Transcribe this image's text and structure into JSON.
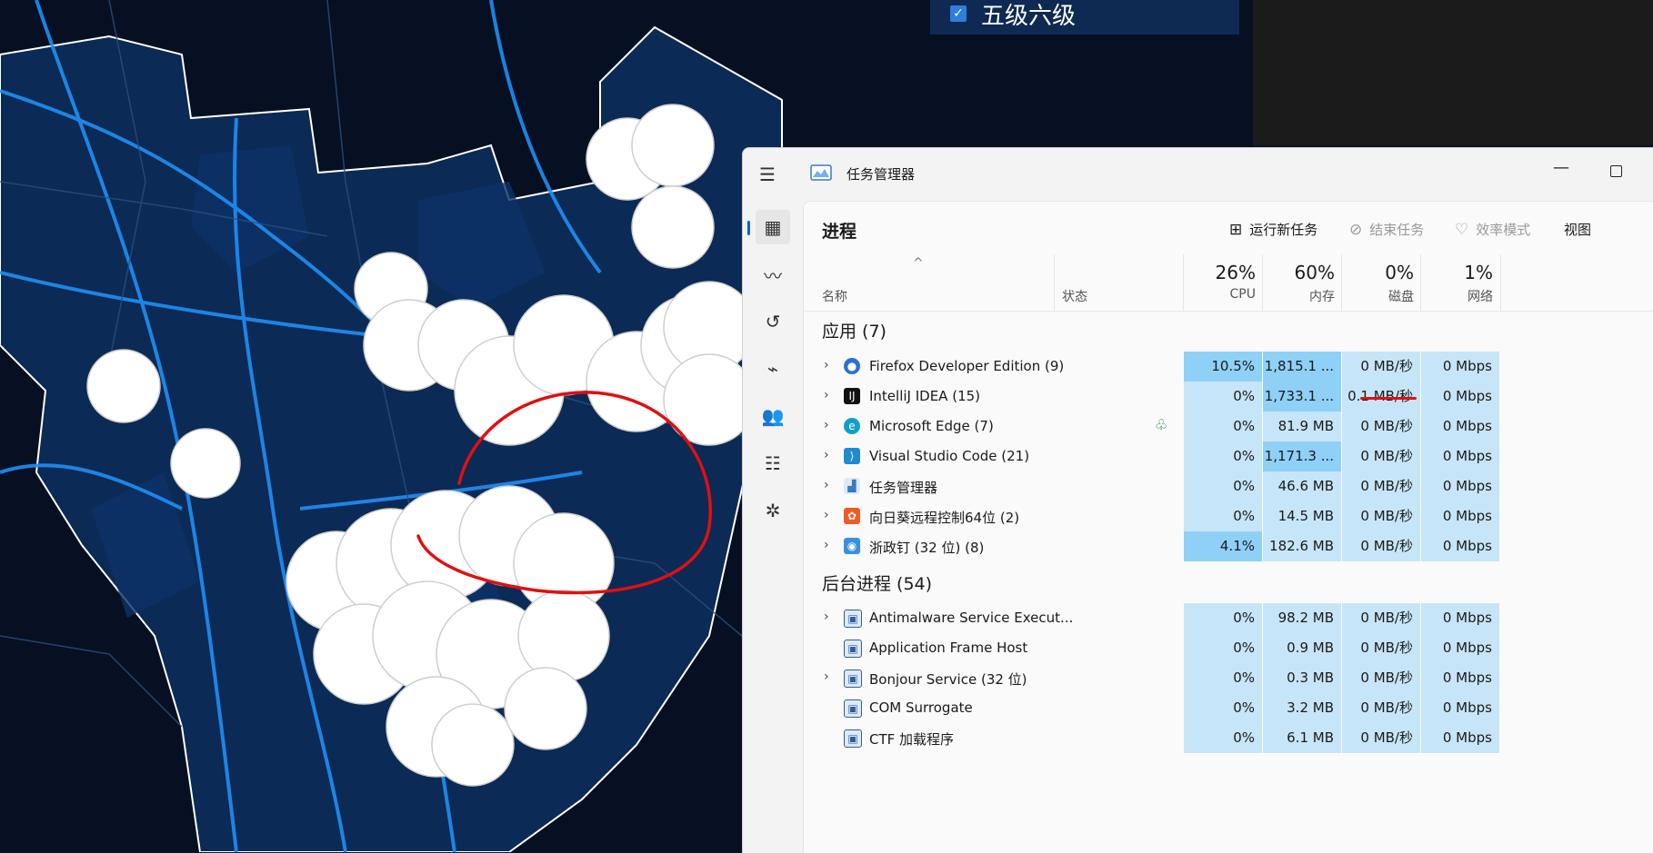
{
  "map": {
    "layer_toggle_label": "五级六级"
  },
  "taskmanager": {
    "title": "任务管理器",
    "page_title": "进程",
    "commands": {
      "run_new_task": "运行新任务",
      "end_task": "结束任务",
      "efficiency_mode": "效率模式",
      "view": "视图"
    },
    "columns": {
      "name": "名称",
      "status": "状态",
      "cpu_pct": "26%",
      "cpu": "CPU",
      "mem_pct": "60%",
      "mem": "内存",
      "disk_pct": "0%",
      "disk": "磁盘",
      "net_pct": "1%",
      "net": "网络"
    },
    "groups": {
      "apps": "应用 (7)",
      "background": "后台进程 (54)"
    },
    "apps": [
      {
        "name": "Firefox Developer Edition (9)",
        "icon": "firefox-icon",
        "cpu": "10.5%",
        "mem": "1,815.1 ...",
        "disk": "0 MB/秒",
        "net": "0 Mbps"
      },
      {
        "name": "IntelliJ IDEA (15)",
        "icon": "intellij-icon",
        "cpu": "0%",
        "mem": "1,733.1 ...",
        "disk": "0.1 MB/秒",
        "net": "0 Mbps"
      },
      {
        "name": "Microsoft Edge (7)",
        "icon": "edge-icon",
        "cpu": "0%",
        "mem": "81.9 MB",
        "disk": "0 MB/秒",
        "net": "0 Mbps"
      },
      {
        "name": "Visual Studio Code (21)",
        "icon": "vscode-icon",
        "cpu": "0%",
        "mem": "1,171.3 ...",
        "disk": "0 MB/秒",
        "net": "0 Mbps"
      },
      {
        "name": "任务管理器",
        "icon": "task-manager-icon",
        "cpu": "0%",
        "mem": "46.6 MB",
        "disk": "0 MB/秒",
        "net": "0 Mbps"
      },
      {
        "name": "向日葵远程控制64位 (2)",
        "icon": "sunlogin-icon",
        "cpu": "0%",
        "mem": "14.5 MB",
        "disk": "0 MB/秒",
        "net": "0 Mbps"
      },
      {
        "name": "浙政钉 (32 位) (8)",
        "icon": "zhezhengding-icon",
        "cpu": "4.1%",
        "mem": "182.6 MB",
        "disk": "0 MB/秒",
        "net": "0 Mbps"
      }
    ],
    "background": [
      {
        "name": "Antimalware Service Execut...",
        "cpu": "0%",
        "mem": "98.2 MB",
        "disk": "0 MB/秒",
        "net": "0 Mbps"
      },
      {
        "name": "Application Frame Host",
        "cpu": "0%",
        "mem": "0.9 MB",
        "disk": "0 MB/秒",
        "net": "0 Mbps"
      },
      {
        "name": "Bonjour Service (32 位)",
        "cpu": "0%",
        "mem": "0.3 MB",
        "disk": "0 MB/秒",
        "net": "0 Mbps"
      },
      {
        "name": "COM Surrogate",
        "cpu": "0%",
        "mem": "3.2 MB",
        "disk": "0 MB/秒",
        "net": "0 Mbps"
      },
      {
        "name": "CTF 加载程序",
        "cpu": "0%",
        "mem": "6.1 MB",
        "disk": "0 MB/秒",
        "net": "0 Mbps"
      }
    ],
    "colors": {
      "heat_light": "#c7e5f8",
      "heat_hot": "#8fd0f7",
      "accent": "#0067c0",
      "annotation": "#e01010"
    }
  }
}
